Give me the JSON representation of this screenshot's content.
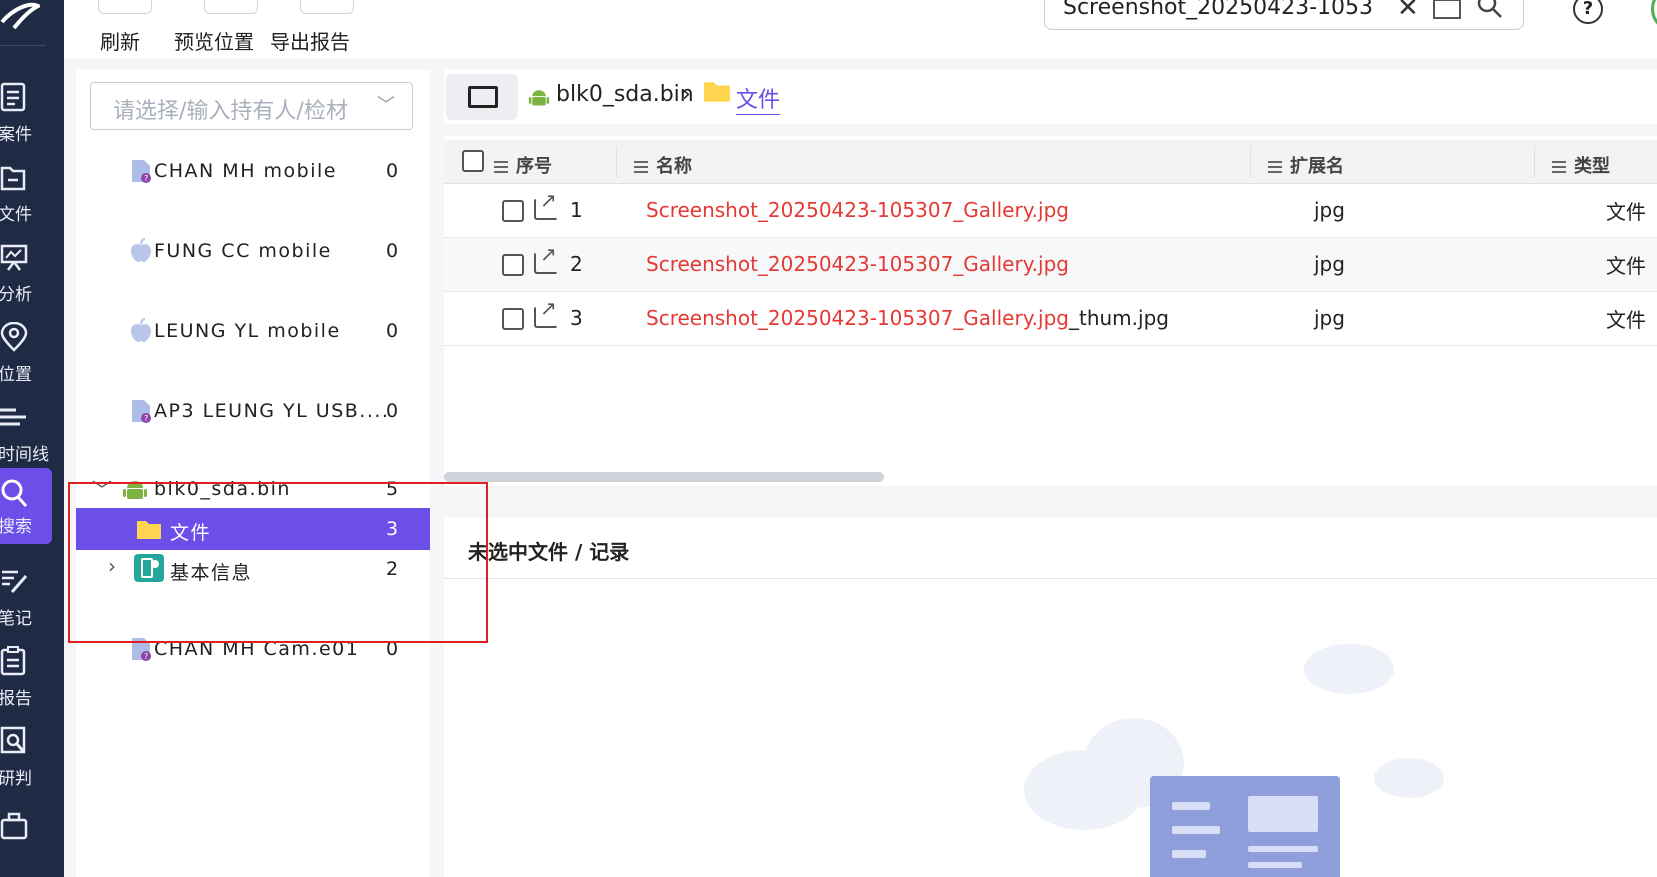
{
  "nav": {
    "items": [
      {
        "label": "案件",
        "icon": "case-icon"
      },
      {
        "label": "文件",
        "icon": "file-icon"
      },
      {
        "label": "分析",
        "icon": "analysis-icon"
      },
      {
        "label": "位置",
        "icon": "location-icon"
      },
      {
        "label": "时间线",
        "icon": "timeline-icon"
      },
      {
        "label": "搜索",
        "icon": "search-icon",
        "active": true
      },
      {
        "label": "笔记",
        "icon": "notes-icon"
      },
      {
        "label": "报告",
        "icon": "report-icon"
      },
      {
        "label": "研判",
        "icon": "judge-icon"
      }
    ]
  },
  "toolbar": {
    "refresh_label": "刷新",
    "preview_location_label": "预览位置",
    "export_report_label": "导出报告"
  },
  "search": {
    "value": "Screenshot_20250423-1053"
  },
  "tree": {
    "holder_placeholder": "请选择/输入持有人/检材",
    "nodes": [
      {
        "name": "CHAN MH mobile",
        "count": "0",
        "icon": "unknown-device-icon"
      },
      {
        "name": "FUNG CC mobile",
        "count": "0",
        "icon": "apple-icon"
      },
      {
        "name": "LEUNG YL mobile",
        "count": "0",
        "icon": "apple-icon"
      },
      {
        "name": "AP3 LEUNG YL USB....",
        "count": "0",
        "icon": "unknown-device-icon"
      },
      {
        "name": "blk0_sda.bin",
        "count": "5",
        "icon": "android-icon"
      },
      {
        "name": "文件",
        "count": "3",
        "icon": "folder-icon"
      },
      {
        "name": "基本信息",
        "count": "2",
        "icon": "device-info-icon"
      },
      {
        "name": "CHAN MH Cam.e01",
        "count": "0",
        "icon": "unknown-device-icon"
      }
    ]
  },
  "breadcrumb": {
    "device": "blk0_sda.bin",
    "sep": "›",
    "folder": "文件"
  },
  "table": {
    "headers": {
      "index": "序号",
      "name": "名称",
      "ext": "扩展名",
      "type": "类型"
    },
    "rows": [
      {
        "index": "1",
        "name_match": "Screenshot_20250423-105307_Gallery.jpg",
        "name_rest": "",
        "ext": "jpg",
        "type": "文件"
      },
      {
        "index": "2",
        "name_match": "Screenshot_20250423-105307_Gallery.jpg",
        "name_rest": "",
        "ext": "jpg",
        "type": "文件"
      },
      {
        "index": "3",
        "name_match": "Screenshot_20250423-105307_Gallery.jpg",
        "name_rest": "_thum.jpg",
        "ext": "jpg",
        "type": "文件"
      }
    ]
  },
  "detail": {
    "title": "未选中文件 / 记录"
  },
  "colors": {
    "nav_bg": "#1f2a44",
    "accent": "#6c4ee8",
    "match_red": "#e53935",
    "highlight_box": "#e02020"
  }
}
